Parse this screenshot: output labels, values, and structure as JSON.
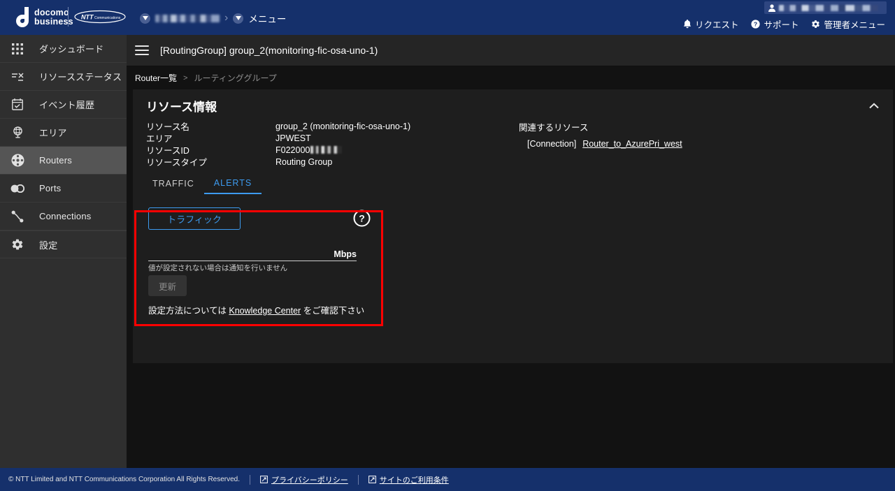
{
  "topbar": {
    "brand_line1": "docomo",
    "brand_line2": "business",
    "ntt_name": "NTT",
    "ntt_sub": "Communications",
    "menu_label": "メニュー",
    "links": [
      {
        "label": "リクエスト",
        "icon": "bell-icon"
      },
      {
        "label": "サポート",
        "icon": "question-circle-icon"
      },
      {
        "label": "管理者メニュー",
        "icon": "gear-icon"
      }
    ]
  },
  "sidebar": {
    "items": [
      {
        "label": "ダッシュボード",
        "icon": "grid-icon",
        "active": false
      },
      {
        "label": "リソースステータス",
        "icon": "resource-status-icon",
        "active": false
      },
      {
        "label": "イベント履歴",
        "icon": "calendar-check-icon",
        "active": false
      },
      {
        "label": "エリア",
        "icon": "globe-icon",
        "active": false
      },
      {
        "label": "Routers",
        "icon": "router-icon",
        "active": true
      },
      {
        "label": "Ports",
        "icon": "ports-icon",
        "active": false
      },
      {
        "label": "Connections",
        "icon": "connections-icon",
        "active": false
      },
      {
        "label": "設定",
        "icon": "gear-icon",
        "active": false
      }
    ]
  },
  "page": {
    "title": "[RoutingGroup] group_2(monitoring-fic-osa-uno-1)",
    "breadcrumb": {
      "parent": "Router一覧",
      "separator": ">",
      "current": "ルーティンググループ"
    }
  },
  "resource_card": {
    "title": "リソース情報",
    "collapse_icon": "chevron-up-icon",
    "rows": [
      {
        "label": "リソース名",
        "value": "group_2 (monitoring-fic-osa-uno-1)",
        "redacted": false
      },
      {
        "label": "エリア",
        "value": "JPWEST",
        "redacted": false
      },
      {
        "label": "リソースID",
        "value": "F022000",
        "redacted": true
      },
      {
        "label": "リソースタイプ",
        "value": "Routing Group",
        "redacted": false
      }
    ],
    "related": {
      "title": "関連するリソース",
      "items": [
        {
          "type": "[Connection]",
          "name": "Router_to_AzurePri_west"
        }
      ]
    }
  },
  "tabs": [
    {
      "label": "TRAFFIC",
      "active": false
    },
    {
      "label": "ALERTS",
      "active": true
    }
  ],
  "alerts_panel": {
    "traffic_button": "トラフィック",
    "help_icon": "question-circle-icon",
    "threshold_value": "",
    "threshold_placeholder": "",
    "unit": "Mbps",
    "hint": "値が設定されない場合は通知を行いません",
    "update_button": "更新",
    "footnote_prefix": "設定方法については",
    "footnote_link": "Knowledge Center",
    "footnote_suffix": "をご確認下さい",
    "highlight_color": "#fe0000"
  },
  "footer": {
    "copyright": "© NTT Limited and NTT Communications Corporation All Rights Reserved.",
    "links": [
      {
        "label": "プライバシーポリシー",
        "icon": "external-link-icon"
      },
      {
        "label": "サイトのご利用条件",
        "icon": "external-link-icon"
      }
    ]
  }
}
